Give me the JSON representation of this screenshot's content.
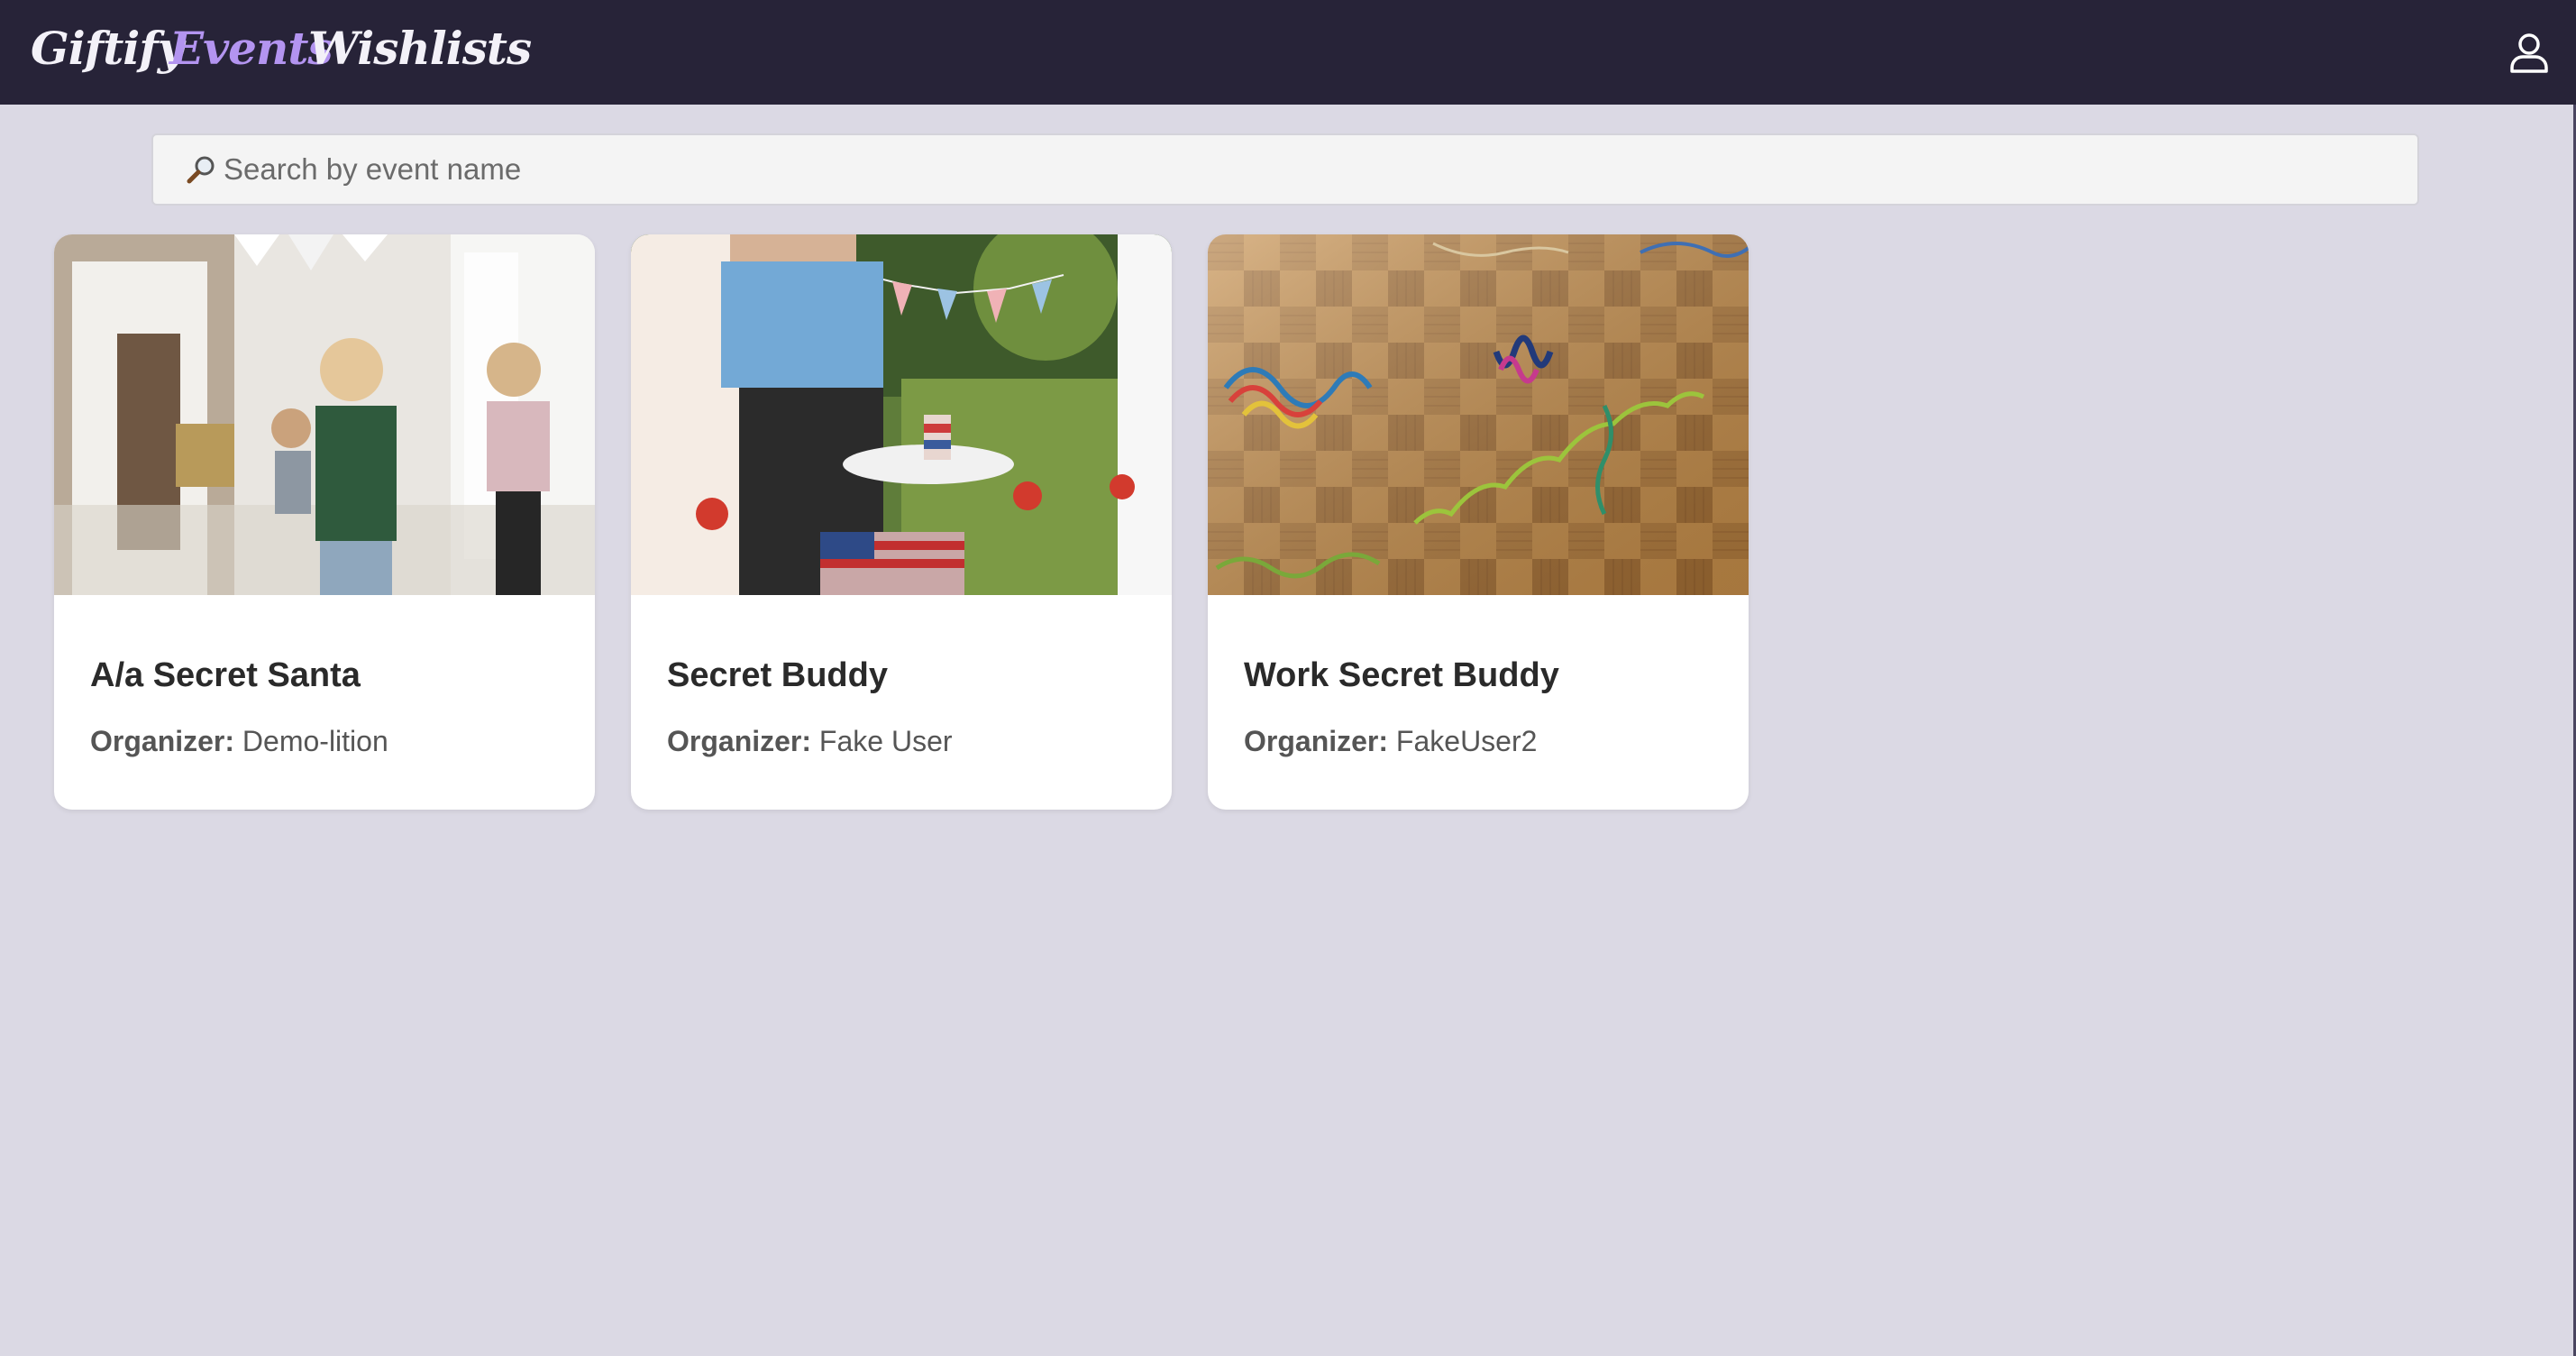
{
  "nav": {
    "brand": "Giftify",
    "events": "Events",
    "wishlists": "Wishlists",
    "profile_icon": "user-icon",
    "active_color": "#b394f0",
    "bar_color": "#272338"
  },
  "search": {
    "icon": "magnifier-icon",
    "placeholder": "Search by event name",
    "value": ""
  },
  "events": [
    {
      "title": "A/a Secret Santa",
      "organizer_label": "Organizer:",
      "organizer": "Demo-lition"
    },
    {
      "title": "Secret Buddy",
      "organizer_label": "Organizer:",
      "organizer": "Fake User"
    },
    {
      "title": "Work Secret Buddy",
      "organizer_label": "Organizer:",
      "organizer": "FakeUser2"
    }
  ]
}
